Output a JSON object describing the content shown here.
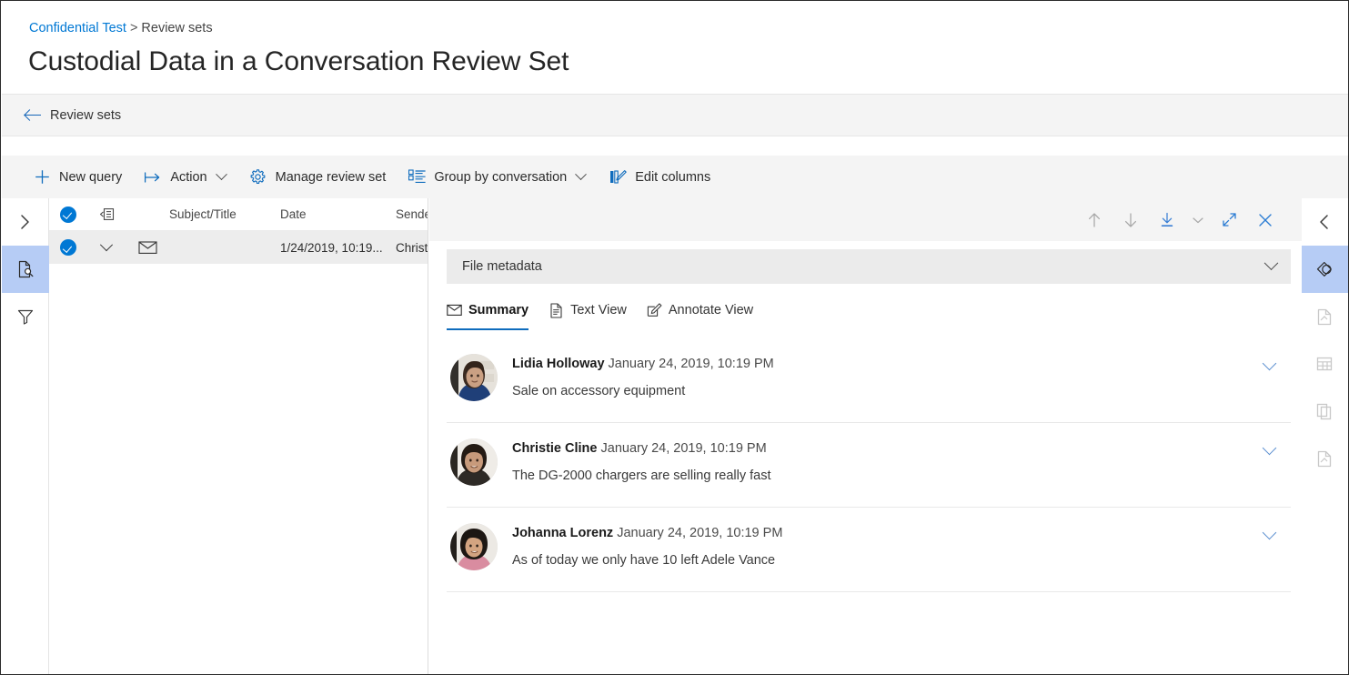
{
  "breadcrumb": {
    "root": "Confidential Test",
    "separator": ">",
    "current": "Review sets"
  },
  "page_title": "Custodial Data in a Conversation Review Set",
  "back_bar": {
    "label": "Review sets",
    "icon": "arrow-left-icon"
  },
  "command_bar": {
    "items": [
      {
        "label": "New query",
        "icon": "plus-icon",
        "caret": false
      },
      {
        "label": "Action",
        "icon": "action-arrow-icon",
        "caret": true
      },
      {
        "label": "Manage review set",
        "icon": "gear-icon",
        "caret": false
      },
      {
        "label": "Group by conversation",
        "icon": "list-group-icon",
        "caret": true
      },
      {
        "label": "Edit columns",
        "icon": "edit-columns-icon",
        "caret": false
      }
    ]
  },
  "left_rail": {
    "items": [
      {
        "name": "expand-panel-icon",
        "state": "normal"
      },
      {
        "name": "document-search-icon",
        "state": "active"
      },
      {
        "name": "filter-funnel-icon",
        "state": "normal"
      }
    ]
  },
  "right_rail": {
    "items": [
      {
        "name": "collapse-panel-icon",
        "state": "normal"
      },
      {
        "name": "tags-icon",
        "state": "active"
      },
      {
        "name": "document-page-icon",
        "state": "dim"
      },
      {
        "name": "table-grid-icon",
        "state": "dim"
      },
      {
        "name": "copies-icon",
        "state": "dim"
      },
      {
        "name": "near-duplicates-icon",
        "state": "dim"
      }
    ]
  },
  "list": {
    "columns": [
      {
        "key": "check",
        "label": ""
      },
      {
        "key": "expand",
        "label": ""
      },
      {
        "key": "type",
        "label": ""
      },
      {
        "key": "subject",
        "label": "Subject/Title"
      },
      {
        "key": "date",
        "label": "Date"
      },
      {
        "key": "sender",
        "label": "Sender"
      }
    ],
    "header_icon": "attachment-column-icon",
    "rows": [
      {
        "selected": true,
        "expand_icon": "chevron-down-icon",
        "type_icon": "email-icon",
        "subject": "",
        "date": "1/24/2019, 10:19...",
        "sender": "Christie"
      }
    ]
  },
  "detail": {
    "toolbar": [
      {
        "name": "previous-item-button",
        "icon": "arrow-up-icon",
        "style": "gray"
      },
      {
        "name": "next-item-button",
        "icon": "arrow-down-icon",
        "style": "gray"
      },
      {
        "name": "download-button",
        "icon": "download-icon",
        "style": "blue"
      },
      {
        "name": "download-options-button",
        "icon": "chevron-down-icon",
        "style": "gray"
      },
      {
        "name": "expand-view-button",
        "icon": "expand-diagonal-icon",
        "style": "blue"
      },
      {
        "name": "close-panel-button",
        "icon": "close-icon",
        "style": "blue"
      }
    ],
    "metadata_bar": {
      "label": "File metadata",
      "caret_icon": "chevron-down-icon"
    },
    "tabs": [
      {
        "label": "Summary",
        "icon": "envelope-icon",
        "active": true
      },
      {
        "label": "Text View",
        "icon": "text-document-icon",
        "active": false
      },
      {
        "label": "Annotate View",
        "icon": "annotate-pen-icon",
        "active": false
      }
    ],
    "messages": [
      {
        "sender": "Lidia Holloway",
        "timestamp": "January 24, 2019, 10:19 PM",
        "text": "Sale on accessory equipment",
        "avatar": "avatar-lidia-holloway",
        "caret_icon": "chevron-down-icon"
      },
      {
        "sender": "Christie Cline",
        "timestamp": "January 24, 2019, 10:19 PM",
        "text": "The DG-2000 chargers are selling really fast",
        "avatar": "avatar-christie-cline",
        "caret_icon": "chevron-down-icon"
      },
      {
        "sender": "Johanna Lorenz",
        "timestamp": "January 24, 2019, 10:19 PM",
        "text": "As of today we only have 10 left Adele Vance",
        "avatar": "avatar-johanna-lorenz",
        "caret_icon": "chevron-down-icon"
      }
    ]
  },
  "colors": {
    "accent": "#0078d4",
    "command_icon": "#0f6cbd",
    "link": "#0078d4",
    "rail_active_bg": "#b6ccf5",
    "row_selected_bg": "#ededed",
    "bar_bg": "#f4f4f4",
    "metabar_bg": "#ebebeb"
  }
}
